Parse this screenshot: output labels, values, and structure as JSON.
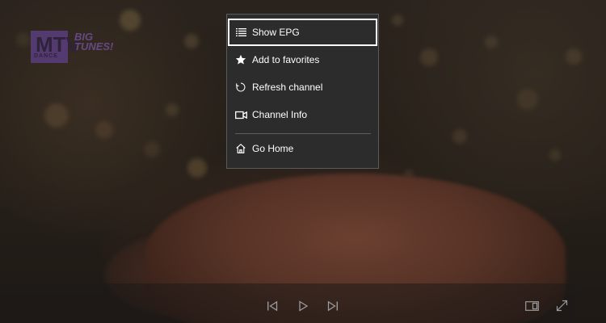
{
  "player": {
    "channel_logo": {
      "brand": "MTV",
      "subtitle": "DANCE",
      "program_badge": "BIG TUNES!"
    }
  },
  "context_menu": {
    "items": [
      {
        "label": "Show EPG",
        "icon": "list-icon",
        "focused": true
      },
      {
        "label": "Add to favorites",
        "icon": "star-icon",
        "focused": false
      },
      {
        "label": "Refresh channel",
        "icon": "refresh-icon",
        "focused": false
      },
      {
        "label": "Channel Info",
        "icon": "video-camera-icon",
        "focused": false
      },
      {
        "label": "Go Home",
        "icon": "home-icon",
        "focused": false
      }
    ]
  },
  "transport_bar": {
    "buttons": [
      {
        "name": "previous",
        "icon": "skip-previous-icon"
      },
      {
        "name": "play",
        "icon": "play-icon"
      },
      {
        "name": "next",
        "icon": "skip-next-icon"
      },
      {
        "name": "compact-overlay",
        "icon": "compact-overlay-icon"
      },
      {
        "name": "fullscreen",
        "icon": "fullscreen-icon"
      }
    ]
  },
  "colors": {
    "menu_background": "#2c2c2c",
    "menu_border": "#5b5b5b",
    "menu_text": "#ffffff",
    "focus_border": "#ffffff",
    "transport_icon": "#9a9a9a"
  }
}
